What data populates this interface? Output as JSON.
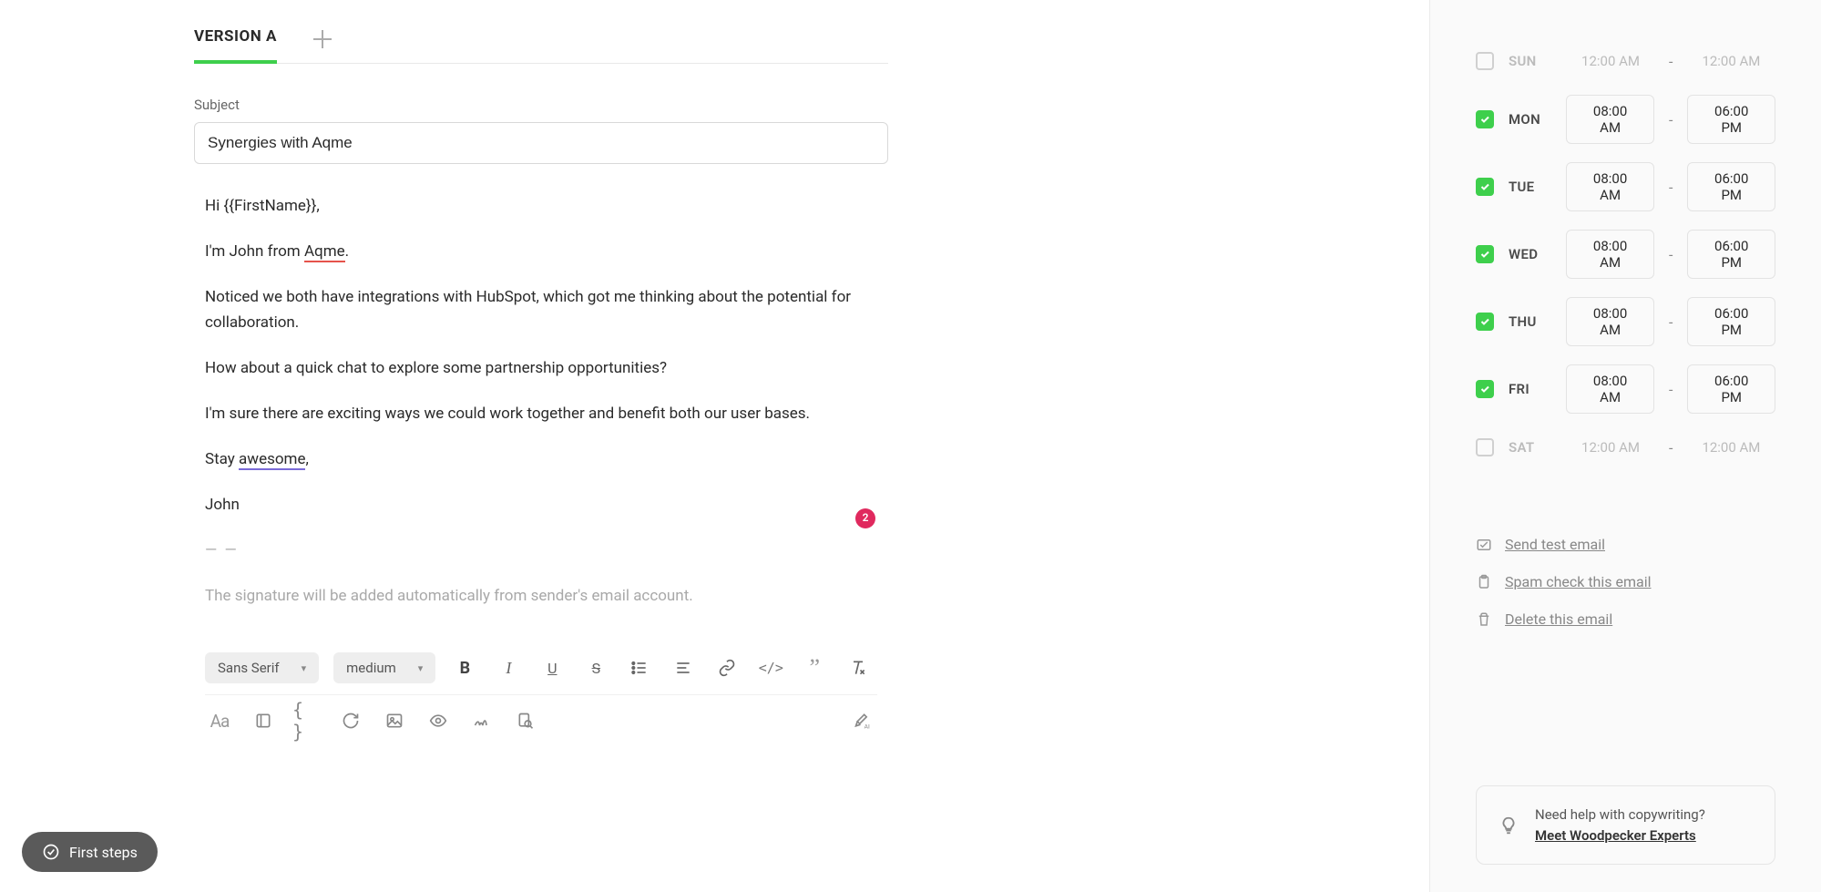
{
  "editor": {
    "tab_label": "VERSION A",
    "subject_label": "Subject",
    "subject_value": "Synergies with Aqme",
    "body": {
      "greeting_prefix": "Hi ",
      "token_firstname": "{{FirstName}}",
      "greeting_suffix": ",",
      "intro_prefix": "I'm John from ",
      "intro_word": "Aqme",
      "intro_suffix": ".",
      "p3": "Noticed we both have integrations with HubSpot, which got me thinking about the potential for collaboration.",
      "p4": "How about a quick chat to explore some partnership opportunities?",
      "p5": "I'm sure there are exciting ways we could work together and benefit both our user bases.",
      "closing_prefix": "Stay ",
      "closing_word": "awesome",
      "closing_suffix": ",",
      "signoff": "John",
      "sig_dashes": "— —",
      "sig_note": "The signature will be added automatically from sender's email account."
    },
    "badge_count": "2",
    "toolbar": {
      "font_family": "Sans Serif",
      "font_size": "medium",
      "bold": "B",
      "italic": "I",
      "underline": "U",
      "strike": "S",
      "code_glyph": "</>",
      "quote_glyph": "”",
      "aa": "Aa",
      "braces": "{ }",
      "ai": "AI"
    }
  },
  "schedule": {
    "days": [
      {
        "day": "SUN",
        "enabled": false,
        "from": "12:00 AM",
        "to": "12:00 AM"
      },
      {
        "day": "MON",
        "enabled": true,
        "from": "08:00 AM",
        "to": "06:00 PM"
      },
      {
        "day": "TUE",
        "enabled": true,
        "from": "08:00 AM",
        "to": "06:00 PM"
      },
      {
        "day": "WED",
        "enabled": true,
        "from": "08:00 AM",
        "to": "06:00 PM"
      },
      {
        "day": "THU",
        "enabled": true,
        "from": "08:00 AM",
        "to": "06:00 PM"
      },
      {
        "day": "FRI",
        "enabled": true,
        "from": "08:00 AM",
        "to": "06:00 PM"
      },
      {
        "day": "SAT",
        "enabled": false,
        "from": "12:00 AM",
        "to": "12:00 AM"
      }
    ]
  },
  "side_actions": {
    "send_test": "Send test email",
    "spam_check": "Spam check this email",
    "delete": "Delete this email"
  },
  "help": {
    "title": "Need help with copywriting?",
    "link": "Meet Woodpecker Experts"
  },
  "first_steps": "First steps"
}
